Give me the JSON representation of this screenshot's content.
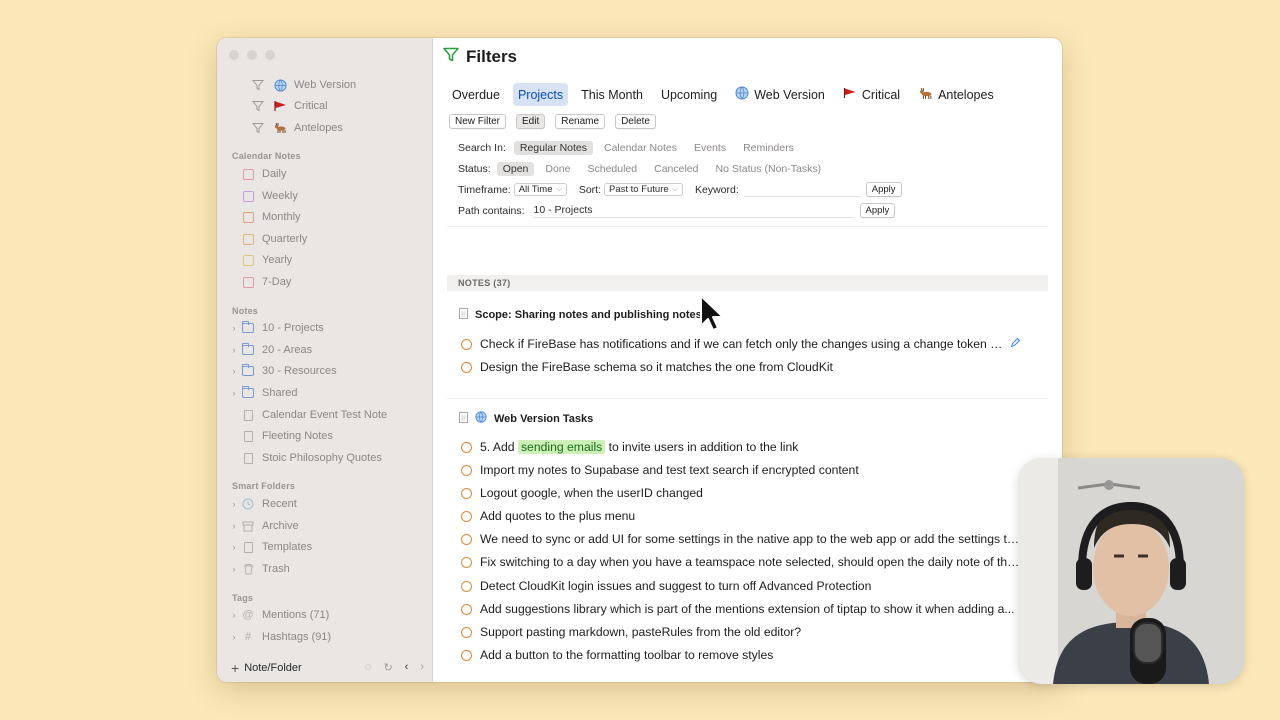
{
  "sidebar": {
    "filters": [
      {
        "label": "Web Version",
        "icon": "globe-icon"
      },
      {
        "label": "Critical",
        "icon": "red-flag-icon"
      },
      {
        "label": "Antelopes",
        "icon": "antelope-icon"
      }
    ],
    "calendar_header": "Calendar Notes",
    "calendar": [
      {
        "label": "Daily",
        "color": "#e39aa0"
      },
      {
        "label": "Weekly",
        "color": "#c99be0"
      },
      {
        "label": "Monthly",
        "color": "#e6a07a"
      },
      {
        "label": "Quarterly",
        "color": "#e6b47a"
      },
      {
        "label": "Yearly",
        "color": "#e6c27a"
      },
      {
        "label": "7-Day",
        "color": "#e39aa0"
      }
    ],
    "notes_header": "Notes",
    "folders": [
      "10 - Projects",
      "20 - Areas",
      "30 - Resources",
      "Shared"
    ],
    "notes": [
      "Calendar Event Test Note",
      "Fleeting Notes",
      "Stoic Philosophy Quotes"
    ],
    "smart_header": "Smart Folders",
    "smart": [
      "Recent",
      "Archive",
      "Templates",
      "Trash"
    ],
    "tags_header": "Tags",
    "tags": [
      "Mentions (71)",
      "Hashtags (91)"
    ],
    "add_label": "Note/Folder"
  },
  "main": {
    "title": "Filters",
    "tabs": [
      {
        "label": "Overdue",
        "active": false,
        "icon": ""
      },
      {
        "label": "Projects",
        "active": true,
        "icon": ""
      },
      {
        "label": "This Month",
        "active": false,
        "icon": ""
      },
      {
        "label": "Upcoming",
        "active": false,
        "icon": ""
      },
      {
        "label": "Web Version",
        "active": false,
        "icon": "globe-icon"
      },
      {
        "label": "Critical",
        "active": false,
        "icon": "red-flag-icon"
      },
      {
        "label": "Antelopes",
        "active": false,
        "icon": "antelope-icon"
      }
    ],
    "buttons": {
      "new": "New Filter",
      "edit": "Edit",
      "rename": "Rename",
      "delete": "Delete"
    },
    "search_in_label": "Search In:",
    "search_in": [
      "Regular Notes",
      "Calendar Notes",
      "Events",
      "Reminders"
    ],
    "status_label": "Status:",
    "status": [
      "Open",
      "Done",
      "Scheduled",
      "Canceled",
      "No Status (Non-Tasks)"
    ],
    "timeframe_label": "Timeframe:",
    "timeframe_value": "All Time",
    "sort_label": "Sort:",
    "sort_value": "Past to Future",
    "keyword_label": "Keyword:",
    "keyword_value": "",
    "apply": "Apply",
    "path_label": "Path contains:",
    "path_value": "10 - Projects",
    "notes_header": "NOTES (37)",
    "groups": [
      {
        "title": "Scope: Sharing notes and publishing notes",
        "tasks": [
          "Check if FireBase has notifications and if we can fetch only the changes using a change token like C...",
          "Design the FireBase schema so it matches the one from CloudKit"
        ]
      },
      {
        "title": "Web Version Tasks",
        "tasks": [
          {
            "pre": "5. Add ",
            "hl": "sending emails",
            "post": " to invite users in addition to the link"
          },
          "Import my notes to Supabase and test text search if encrypted content",
          "Logout google, when the userID changed",
          "Add quotes to the plus menu",
          "We need to sync or add UI for some settings in the native app to the web app or add the settings to th...",
          "Fix switching to a day when you have a teamspace note selected, should open the daily note of the te...",
          "Detect CloudKit login issues and suggest to turn off Advanced Protection",
          "Add suggestions library which is part of the mentions extension of tiptap to show it when adding a...",
          "Support pasting markdown, pasteRules from the old editor?",
          "Add a button to the formatting toolbar to remove styles"
        ]
      }
    ]
  }
}
